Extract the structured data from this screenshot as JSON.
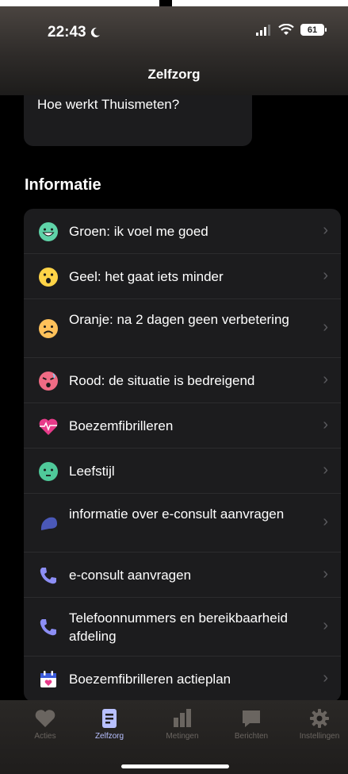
{
  "status_bar": {
    "time": "22:43",
    "battery": "61"
  },
  "header": {
    "title": "Zelfzorg"
  },
  "top_card": {
    "label": "Hoe werkt Thuismeten?"
  },
  "section": {
    "title": "Informatie"
  },
  "items": [
    {
      "label": "Groen: ik voel me goed",
      "icon": "green-smile-icon"
    },
    {
      "label": "Geel: het gaat iets minder",
      "icon": "yellow-surprised-icon"
    },
    {
      "label": "Oranje: na 2 dagen geen verbetering",
      "icon": "orange-sad-icon"
    },
    {
      "label": "Rood: de situatie is bedreigend",
      "icon": "red-face-icon"
    },
    {
      "label": "Boezemfibrilleren",
      "icon": "heart-pulse-icon"
    },
    {
      "label": "Leefstijl",
      "icon": "green-face-icon"
    },
    {
      "label": "informatie over e-consult aanvragen",
      "icon": "chat-bubble-icon"
    },
    {
      "label": "e-consult aanvragen",
      "icon": "phone-icon"
    },
    {
      "label": "Telefoonnummers en bereikbaarheid afdeling",
      "icon": "phone-icon"
    },
    {
      "label": "Boezemfibrilleren actieplan",
      "icon": "calendar-heart-icon"
    }
  ],
  "tabs": [
    {
      "label": "Acties",
      "icon": "heart-icon"
    },
    {
      "label": "Zelfzorg",
      "icon": "list-icon",
      "active": true
    },
    {
      "label": "Metingen",
      "icon": "bar-chart-icon"
    },
    {
      "label": "Berichten",
      "icon": "message-icon"
    },
    {
      "label": "Instellingen",
      "icon": "gear-icon"
    }
  ]
}
